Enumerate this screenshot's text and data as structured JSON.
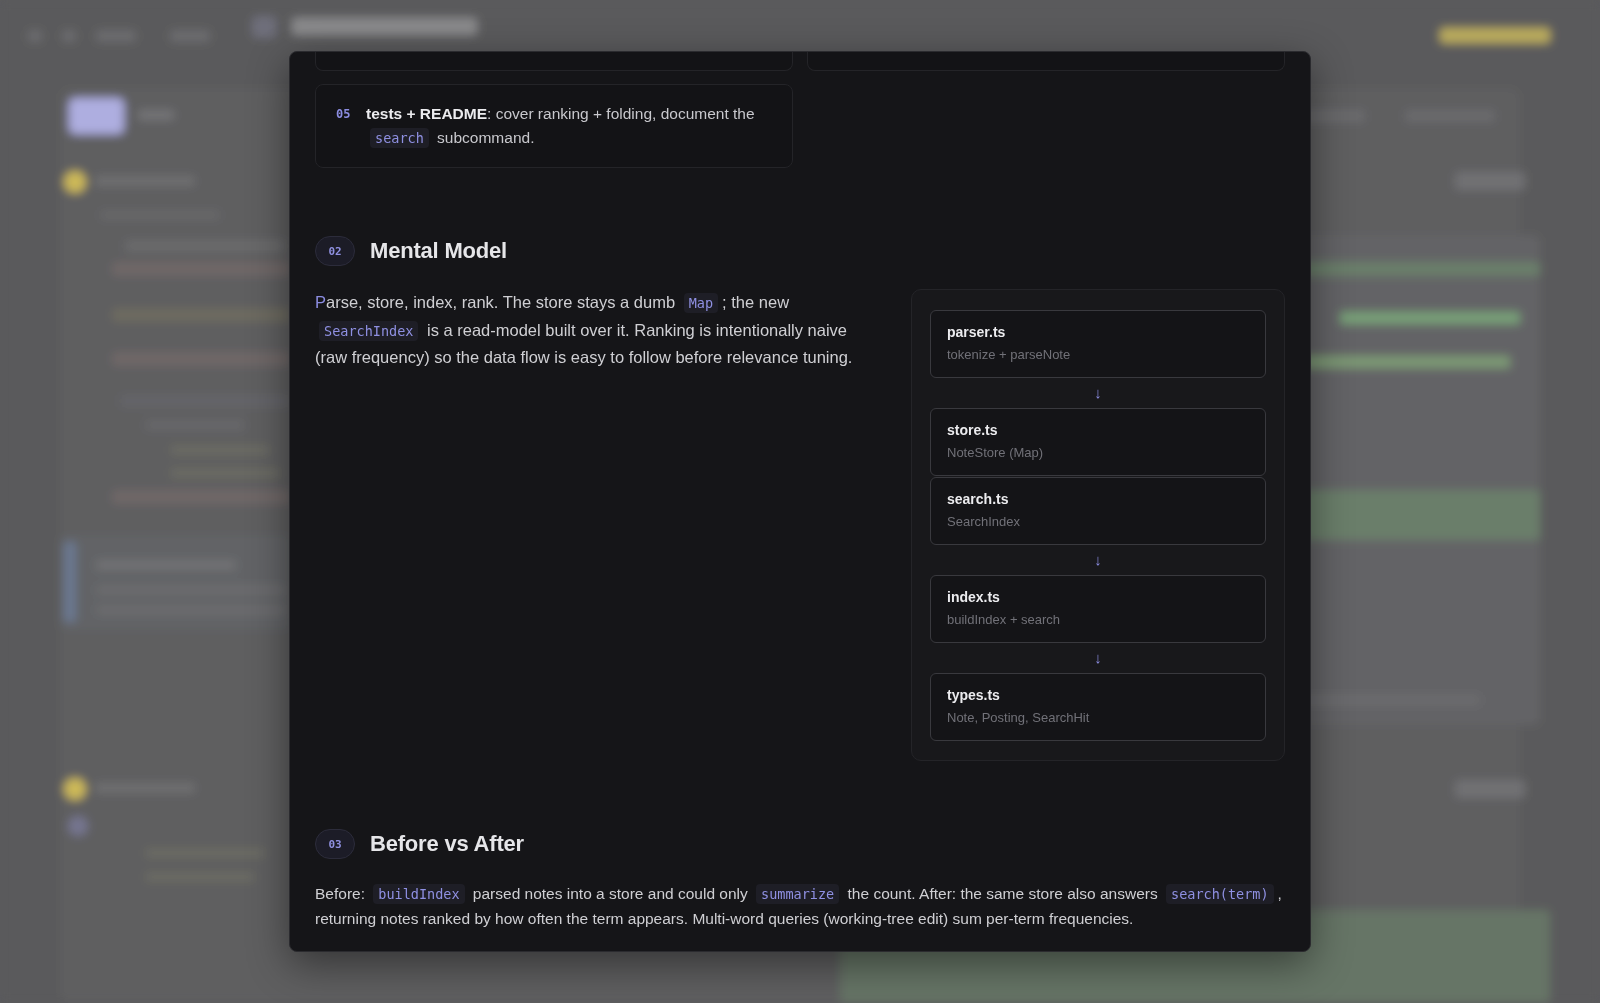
{
  "dialog": {
    "steps": [
      {
        "number": "05",
        "text": [
          {
            "kind": "bold",
            "text": "tests + README"
          },
          {
            "kind": "text",
            "text": ": cover ranking + folding, document the "
          },
          {
            "kind": "code",
            "text": "search"
          },
          {
            "kind": "text",
            "text": " subcommand."
          }
        ]
      }
    ],
    "sections": [
      {
        "number": "02",
        "title": "Mental Model",
        "drop_cap": true,
        "paragraph": [
          {
            "kind": "text",
            "text": "Parse, store, index, rank. The store stays a dumb "
          },
          {
            "kind": "code",
            "text": "Map"
          },
          {
            "kind": "text",
            "text": "; the new "
          },
          {
            "kind": "code",
            "text": "SearchIndex"
          },
          {
            "kind": "text",
            "text": " is a read-model built over it. Ranking is intentionally naive (raw frequency) so the data flow is easy to follow before relevance tuning."
          }
        ],
        "flow": [
          {
            "kind": "node",
            "file": "parser.ts",
            "detail": "tokenize + parseNote"
          },
          {
            "kind": "arrow",
            "glyph": "↓"
          },
          {
            "kind": "node",
            "file": "store.ts",
            "detail": "NoteStore (Map)"
          },
          {
            "kind": "node",
            "file": "search.ts",
            "detail": "SearchIndex"
          },
          {
            "kind": "arrow",
            "glyph": "↓"
          },
          {
            "kind": "node",
            "file": "index.ts",
            "detail": "buildIndex + search"
          },
          {
            "kind": "arrow",
            "glyph": "↓"
          },
          {
            "kind": "node",
            "file": "types.ts",
            "detail": "Note, Posting, SearchHit"
          }
        ]
      },
      {
        "number": "03",
        "title": "Before vs After",
        "drop_cap": false,
        "paragraph": [
          {
            "kind": "text",
            "text": "Before: "
          },
          {
            "kind": "code",
            "text": "buildIndex"
          },
          {
            "kind": "text",
            "text": " parsed notes into a store and could only "
          },
          {
            "kind": "code",
            "text": "summarize"
          },
          {
            "kind": "text",
            "text": " the count. After: the same store also answers "
          },
          {
            "kind": "code",
            "text": "search(term)"
          },
          {
            "kind": "text",
            "text": ", returning notes ranked by how often the term appears. Multi-word queries (working-tree edit) sum per-term frequencies."
          }
        ]
      }
    ]
  }
}
